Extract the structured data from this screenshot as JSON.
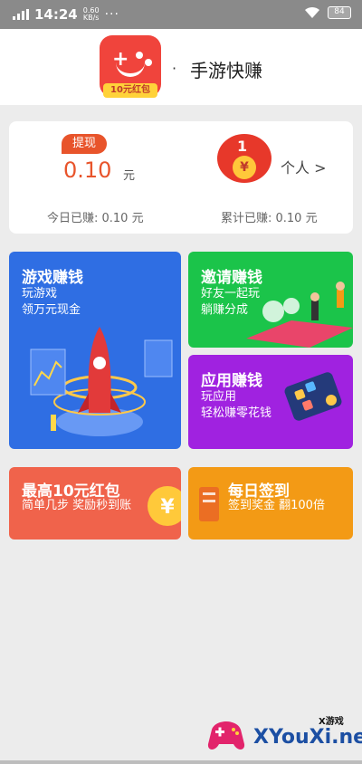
{
  "status_bar": {
    "time": "14:24",
    "speed_value": "0.60",
    "speed_unit": "KB/s",
    "more": "···",
    "battery": "84"
  },
  "header": {
    "app_name": "手游快赚",
    "icon_badge": "10元红包",
    "separator": "·"
  },
  "earnings": {
    "withdraw_label": "提现",
    "balance": "0.10",
    "balance_unit": "元",
    "personal_label": "个人 >",
    "today_earned": "今日已赚: 0.10 元",
    "total_earned": "累计已赚: 0.10 元",
    "envelope_rank": "1",
    "coin_symbol": "¥"
  },
  "tiles": {
    "game": {
      "title": "游戏赚钱",
      "line1": "玩游戏",
      "line2": "领万元现金",
      "color": "#2f6ee3"
    },
    "invite": {
      "title": "邀请赚钱",
      "line1": "好友一起玩",
      "line2": "躺赚分成",
      "color": "#1bc44a"
    },
    "app": {
      "title": "应用赚钱",
      "line1": "玩应用",
      "line2": "轻松赚零花钱",
      "color": "#a022e0"
    },
    "hongbao": {
      "title": "最高10元红包",
      "line1": "简单几步 奖励秒到账",
      "color": "#f0634b"
    },
    "sign": {
      "title": "每日签到",
      "line1": "签到奖金 翻100倍",
      "color": "#f39a15"
    }
  },
  "watermark": {
    "site": "XYouXi.net",
    "small": "X游戏"
  },
  "accent_color": "#e8542b"
}
